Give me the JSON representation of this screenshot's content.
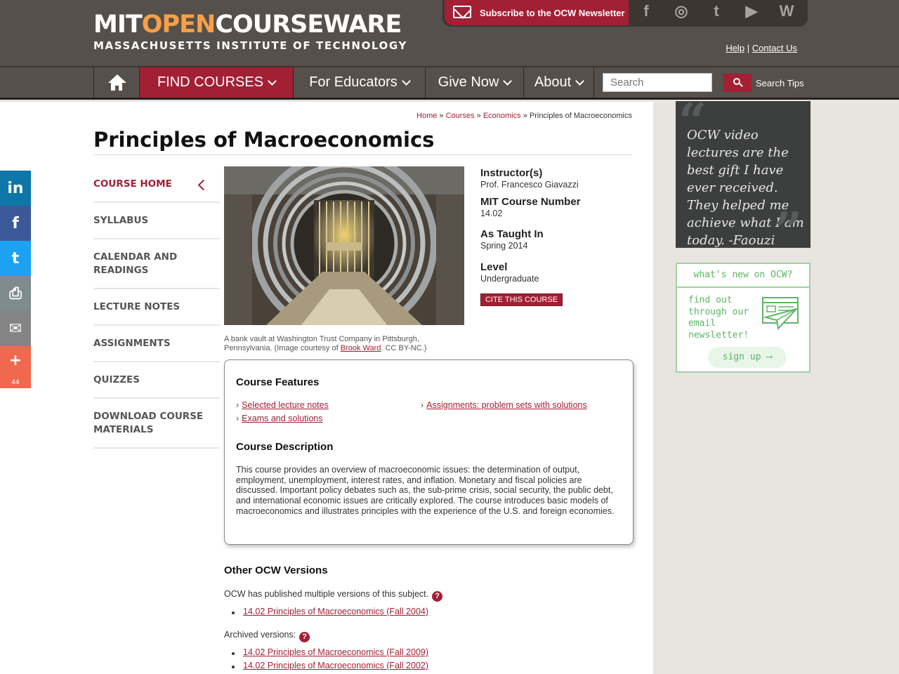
{
  "header": {
    "logo_part1": "MIT",
    "logo_part2": "OPEN",
    "logo_part3": "COURSEWARE",
    "logo_sub": "MASSACHUSETTS INSTITUTE OF TECHNOLOGY",
    "subscribe_label": "Subscribe to the OCW Newsletter",
    "help_label": "Help",
    "contact_label": "Contact Us",
    "social_icons": [
      "facebook-icon",
      "instagram-icon",
      "twitter-icon",
      "youtube-icon",
      "wordpress-icon"
    ],
    "social_glyphs": [
      "f",
      "◎",
      "t",
      "▶",
      "W"
    ]
  },
  "nav": {
    "find_courses": "FIND COURSES",
    "for_educators": "For Educators",
    "give_now": "Give Now",
    "about": "About",
    "search_placeholder": "Search",
    "search_tips": "Search Tips"
  },
  "breadcrumb": {
    "home": "Home",
    "courses": "Courses",
    "economics": "Economics",
    "current": "Principles of Macroeconomics",
    "sep": "»"
  },
  "page": {
    "title": "Principles of Macroeconomics"
  },
  "course_menu": [
    {
      "label": "COURSE HOME"
    },
    {
      "label": "SYLLABUS"
    },
    {
      "label": "CALENDAR AND READINGS"
    },
    {
      "label": "LECTURE NOTES"
    },
    {
      "label": "ASSIGNMENTS"
    },
    {
      "label": "QUIZZES"
    },
    {
      "label": "DOWNLOAD COURSE MATERIALS"
    }
  ],
  "share": {
    "linkedin": "in",
    "facebook": "f",
    "twitter": "t",
    "print": "⎙",
    "email": "✉",
    "more": "+",
    "count": "44"
  },
  "image": {
    "caption_prefix": "A bank vault at Washington Trust Company in Pittsburgh, Pennsylvania. (Image courtesy of",
    "caption_link": "Brook Ward",
    "caption_suffix": ". CC BY-NC.)"
  },
  "info": {
    "instructor_label": "Instructor(s)",
    "instructor_value": "Prof. Francesco Giavazzi",
    "number_label": "MIT Course Number",
    "number_value": "14.02",
    "taught_label": "As Taught In",
    "taught_value": "Spring 2014",
    "level_label": "Level",
    "level_value": "Undergraduate",
    "cite_label": "CITE THIS COURSE"
  },
  "features": {
    "title": "Course Features",
    "items": [
      "Selected lecture notes",
      "Exams and solutions",
      "Assignments: problem sets with solutions"
    ],
    "desc_title": "Course Description",
    "description": "This course provides an overview of macroeconomic issues: the determination of output, employment, unemployment, interest rates, and inflation. Monetary and fiscal policies are discussed. Important policy debates such as, the sub-prime crisis, social security, the public debt, and international economic issues are critically explored. The course introduces basic models of macroeconomics and illustrates principles with the experience of the U.S. and foreign economies."
  },
  "other_versions": {
    "title": "Other OCW Versions",
    "published_text": "OCW has published multiple versions of this subject.",
    "published_links": [
      "14.02 Principles of Macroeconomics (Fall 2004)"
    ],
    "archived_text": "Archived versions:",
    "archived_links": [
      "14.02 Principles of Macroeconomics (Fall 2009)",
      "14.02 Principles of Macroeconomics (Fall 2002)"
    ],
    "help_glyph": "?"
  },
  "sidebar": {
    "quote": "OCW video lectures are the best gift I have ever received. They helped me achieve what I am today. -Faouzi",
    "news_header": "what's new on OCW?",
    "news_body": "find out through our email newsletter!",
    "signup_label": "sign up ⟶"
  },
  "colors": {
    "brand_red": "#a31f34",
    "header_bg": "#56504c",
    "logo_orange": "#f7a046",
    "news_green": "#5cb665"
  }
}
